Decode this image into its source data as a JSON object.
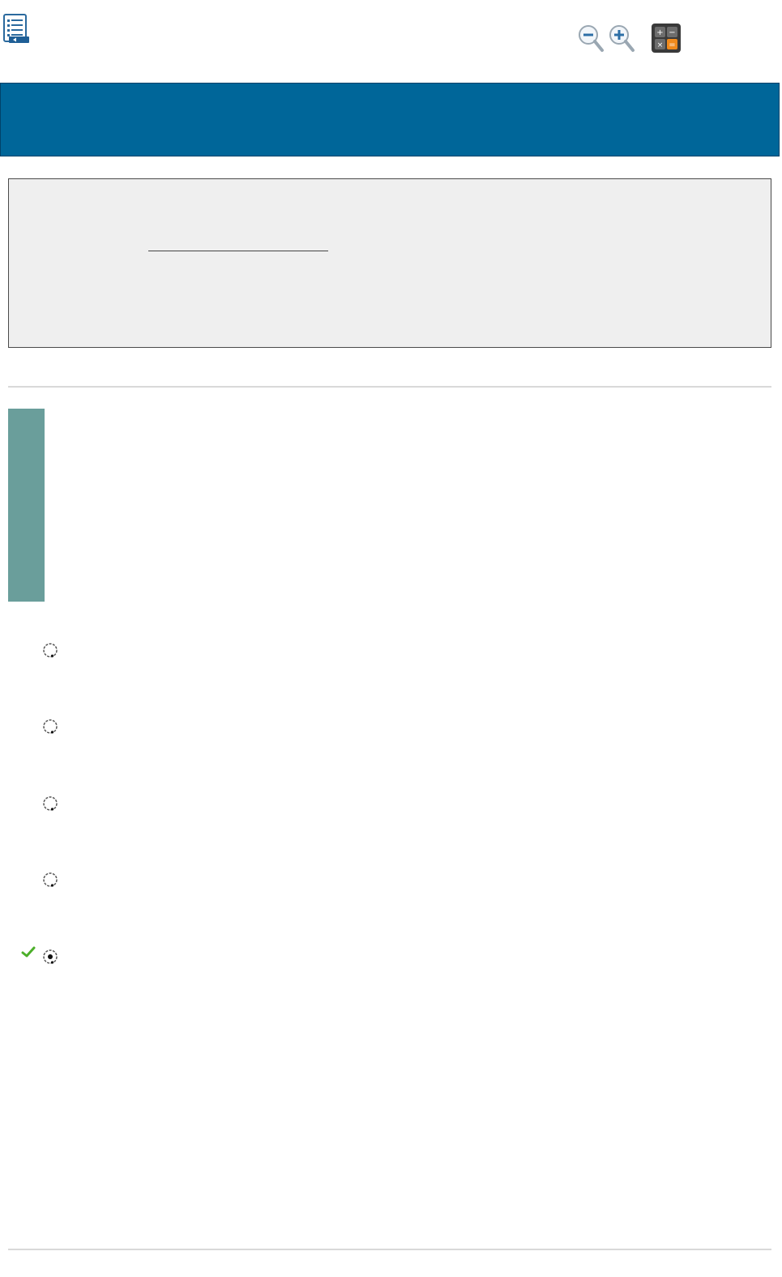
{
  "toolbar": {
    "icons": [
      "table-of-contents-icon",
      "zoom-out-icon",
      "zoom-in-icon",
      "calculator-icon"
    ]
  },
  "colors": {
    "header_bar": "#006699",
    "stimulus_background": "#efefef",
    "question_tab": "#6a9e9b",
    "correct_check": "#4caf2a"
  },
  "answer_options": [
    {
      "selected": false,
      "correct": false
    },
    {
      "selected": false,
      "correct": false
    },
    {
      "selected": false,
      "correct": false
    },
    {
      "selected": false,
      "correct": false
    },
    {
      "selected": true,
      "correct": true
    }
  ]
}
